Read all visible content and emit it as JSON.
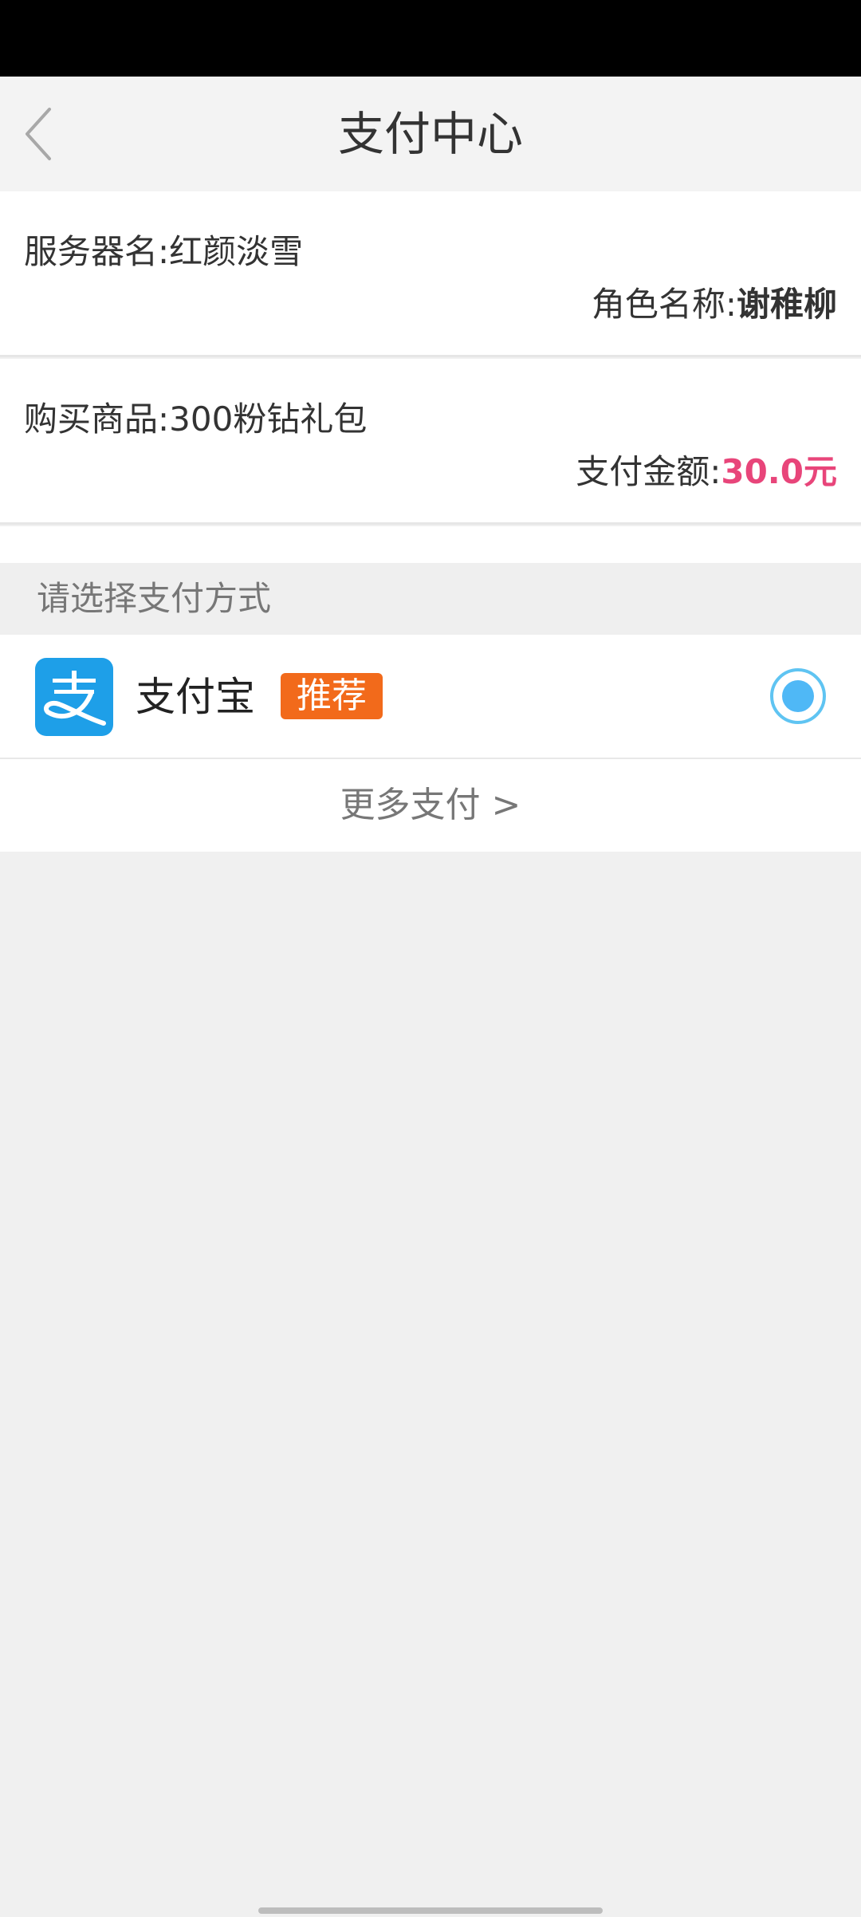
{
  "header": {
    "title": "支付中心",
    "back_icon": "chevron-left-icon"
  },
  "order": {
    "server_label": "服务器名:",
    "server_value": "红颜淡雪",
    "role_label": "角色名称:",
    "role_value": "谢稚柳",
    "product_label": "购买商品:",
    "product_value": "300粉钻礼包",
    "amount_label": "支付金额:",
    "amount_value": "30.0元"
  },
  "payment": {
    "section_label": "请选择支付方式",
    "methods": [
      {
        "name": "支付宝",
        "icon": "alipay-icon",
        "badge": "推荐",
        "selected": true
      }
    ],
    "more_label": "更多支付 >"
  },
  "colors": {
    "accent_blue": "#1e9fe8",
    "amount_pink": "#e8457a",
    "badge_orange": "#f26a1b",
    "radio_blue": "#4fb8f6"
  }
}
